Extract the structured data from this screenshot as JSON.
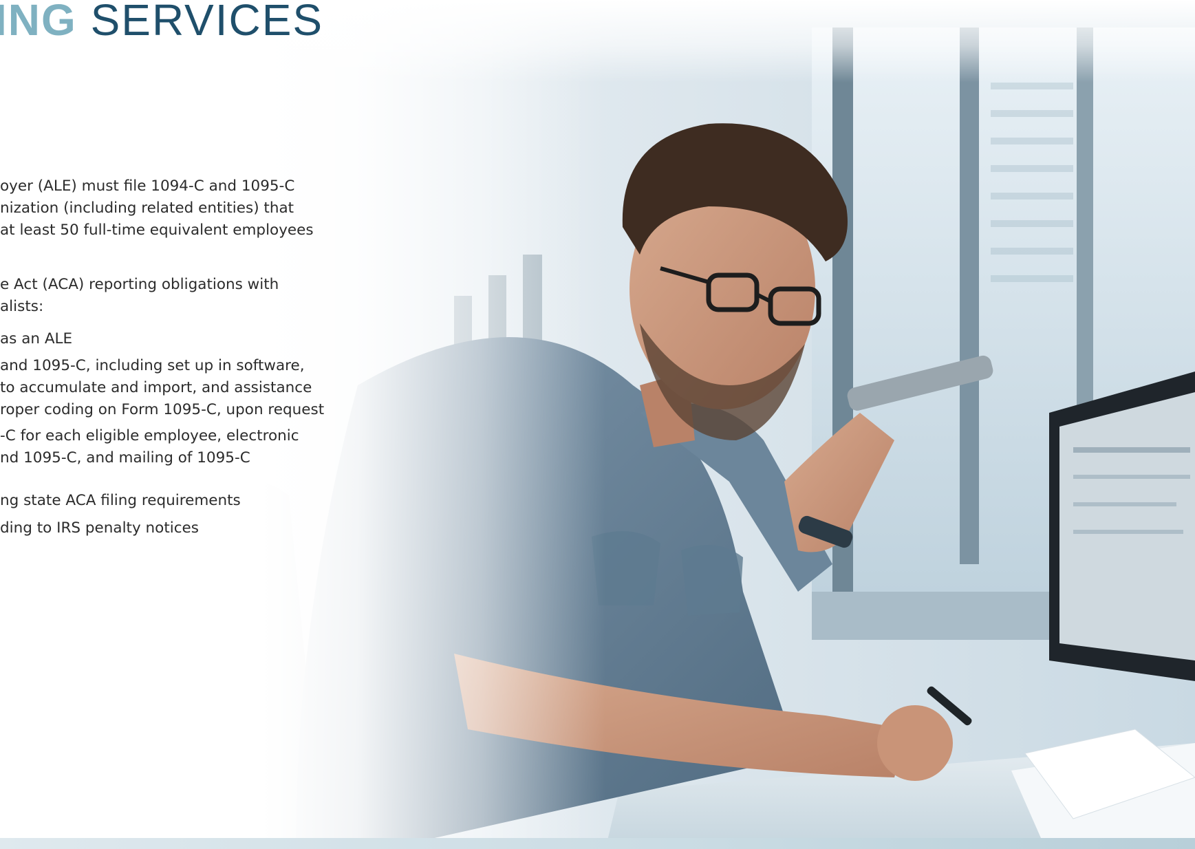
{
  "heading": {
    "accent": "ING",
    "main": "SERVICES"
  },
  "intro": {
    "lines": [
      "oyer (ALE) must file 1094-C and 1095-C",
      "nization (including related entities) that",
      "at least 50 full-time equivalent employees"
    ]
  },
  "lead": {
    "lines": [
      "e Act (ACA) reporting obligations with",
      "alists:"
    ]
  },
  "services": [
    {
      "lines": [
        "as an ALE"
      ]
    },
    {
      "lines": [
        "and 1095-C, including set up in software,",
        "to accumulate and import, and assistance",
        "roper coding on Form 1095-C, upon request"
      ]
    },
    {
      "lines": [
        "-C for each eligible employee, electronic",
        "nd 1095-C, and mailing of 1095-C"
      ]
    },
    {
      "lines": [
        "ng state ACA filing requirements"
      ]
    },
    {
      "lines": [
        "ding to IRS penalty notices"
      ]
    }
  ],
  "colors": {
    "accent": "#7fb1c1",
    "heading": "#1f4f6b",
    "body_text": "#2b2b2b"
  }
}
